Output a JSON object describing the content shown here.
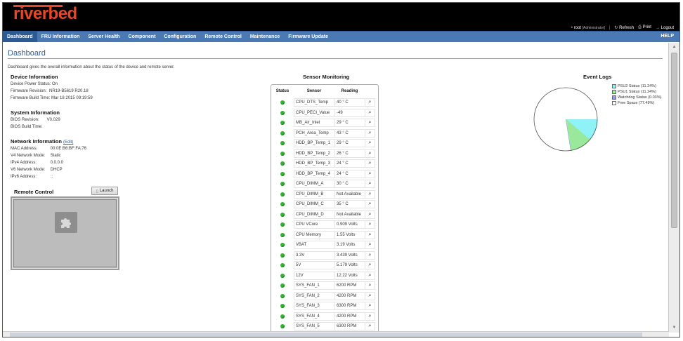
{
  "header": {
    "logo": "riverbed",
    "user": "root",
    "role": "[Administrator]",
    "refresh_label": "Refresh",
    "print_label": "Print",
    "logout_label": "Logout",
    "colors": {
      "logo": "#e8462a",
      "nav": "#4a79b3",
      "nav_active": "#2d5a93"
    }
  },
  "nav": {
    "items": [
      {
        "label": "Dashboard",
        "active": true
      },
      {
        "label": "FRU Information"
      },
      {
        "label": "Server Health"
      },
      {
        "label": "Component"
      },
      {
        "label": "Configuration"
      },
      {
        "label": "Remote Control"
      },
      {
        "label": "Maintenance"
      },
      {
        "label": "Firmware Update"
      }
    ],
    "help_label": "HELP"
  },
  "page": {
    "title": "Dashboard",
    "description": "Dashboard gives the overall information about the status of the device and remote server."
  },
  "device_info": {
    "heading": "Device Information",
    "power_label": "Device Power Status:",
    "power_value": "On",
    "fw_rev_label": "Firmware Revision:",
    "fw_rev_value": "NR19-B5619 R20.18",
    "fw_build_label": "Firmware Build Time:",
    "fw_build_value": "Mar 18 2015 09:19:59"
  },
  "system_info": {
    "heading": "System Information",
    "bios_rev_label": "BIOS Revision:",
    "bios_rev_value": "V0.029",
    "bios_build_label": "BIOS Build Time:",
    "bios_build_value": ""
  },
  "network_info": {
    "heading": "Network Information",
    "edit_label": "(Edit)",
    "mac_label": "MAC Address:",
    "mac_value": "00:0E:B6:BF:FA:76",
    "v4_mode_label": "V4 Network Mode:",
    "v4_mode_value": "Static",
    "ipv4_label": "IPv4 Address:",
    "ipv4_value": "0.0.0.0",
    "v6_mode_label": "V6 Network Mode:",
    "v6_mode_value": "DHCP",
    "ipv6_label": "IPv6 Address:",
    "ipv6_value": "::"
  },
  "remote_control": {
    "heading": "Remote Control",
    "launch_label": "Launch",
    "preview_icon": "puzzle-piece-icon"
  },
  "sensor_monitoring": {
    "title": "Sensor Monitoring",
    "col_status": "Status",
    "col_sensor": "Sensor",
    "col_reading": "Reading",
    "status_color": "#2fb52f",
    "detail_icon": "magnifier-icon",
    "rows": [
      {
        "sensor": "CPU_DTS_Temp",
        "reading": "40 ° C"
      },
      {
        "sensor": "CPU_PECI_Value",
        "reading": "-49"
      },
      {
        "sensor": "MB_Air_Inlet",
        "reading": "29 ° C"
      },
      {
        "sensor": "PCH_Area_Temp",
        "reading": "43 ° C"
      },
      {
        "sensor": "HDD_BP_Temp_1",
        "reading": "29 ° C"
      },
      {
        "sensor": "HDD_BP_Temp_2",
        "reading": "26 ° C"
      },
      {
        "sensor": "HDD_BP_Temp_3",
        "reading": "24 ° C"
      },
      {
        "sensor": "HDD_BP_Temp_4",
        "reading": "24 ° C"
      },
      {
        "sensor": "CPU_DIMM_A",
        "reading": "30 ° C"
      },
      {
        "sensor": "CPU_DIMM_B",
        "reading": "Not Available"
      },
      {
        "sensor": "CPU_DIMM_C",
        "reading": "35 ° C"
      },
      {
        "sensor": "CPU_DIMM_D",
        "reading": "Not Available"
      },
      {
        "sensor": "CPU VCore",
        "reading": "0.909 Volts"
      },
      {
        "sensor": "CPU Memory",
        "reading": "1.55 Volts"
      },
      {
        "sensor": "VBAT",
        "reading": "3.19 Volts"
      },
      {
        "sensor": "3.3V",
        "reading": "3.439 Volts"
      },
      {
        "sensor": "5V",
        "reading": "5.179 Volts"
      },
      {
        "sensor": "12V",
        "reading": "12.22 Volts"
      },
      {
        "sensor": "SYS_FAN_1",
        "reading": "6200 RPM"
      },
      {
        "sensor": "SYS_FAN_2",
        "reading": "4200 RPM"
      },
      {
        "sensor": "SYS_FAN_3",
        "reading": "6300 RPM"
      },
      {
        "sensor": "SYS_FAN_4",
        "reading": "4200 RPM"
      },
      {
        "sensor": "SYS_FAN_5",
        "reading": "6300 RPM"
      }
    ]
  },
  "event_logs": {
    "title": "Event Logs",
    "chart_data": {
      "type": "pie",
      "title": "Event Logs",
      "slices": [
        {
          "label": "PSU2 Status (11.24%)",
          "value": 11.24,
          "color": "#8ef2f6"
        },
        {
          "label": "PSU1 Status (11.24%)",
          "value": 11.24,
          "color": "#9ae89a"
        },
        {
          "label": "Watchdog Status (0.03%)",
          "value": 0.03,
          "color": "#9a9ae8"
        },
        {
          "label": "Free Space (77.49%)",
          "value": 77.49,
          "color": "#ffffff"
        }
      ],
      "legend_position": "right"
    }
  }
}
